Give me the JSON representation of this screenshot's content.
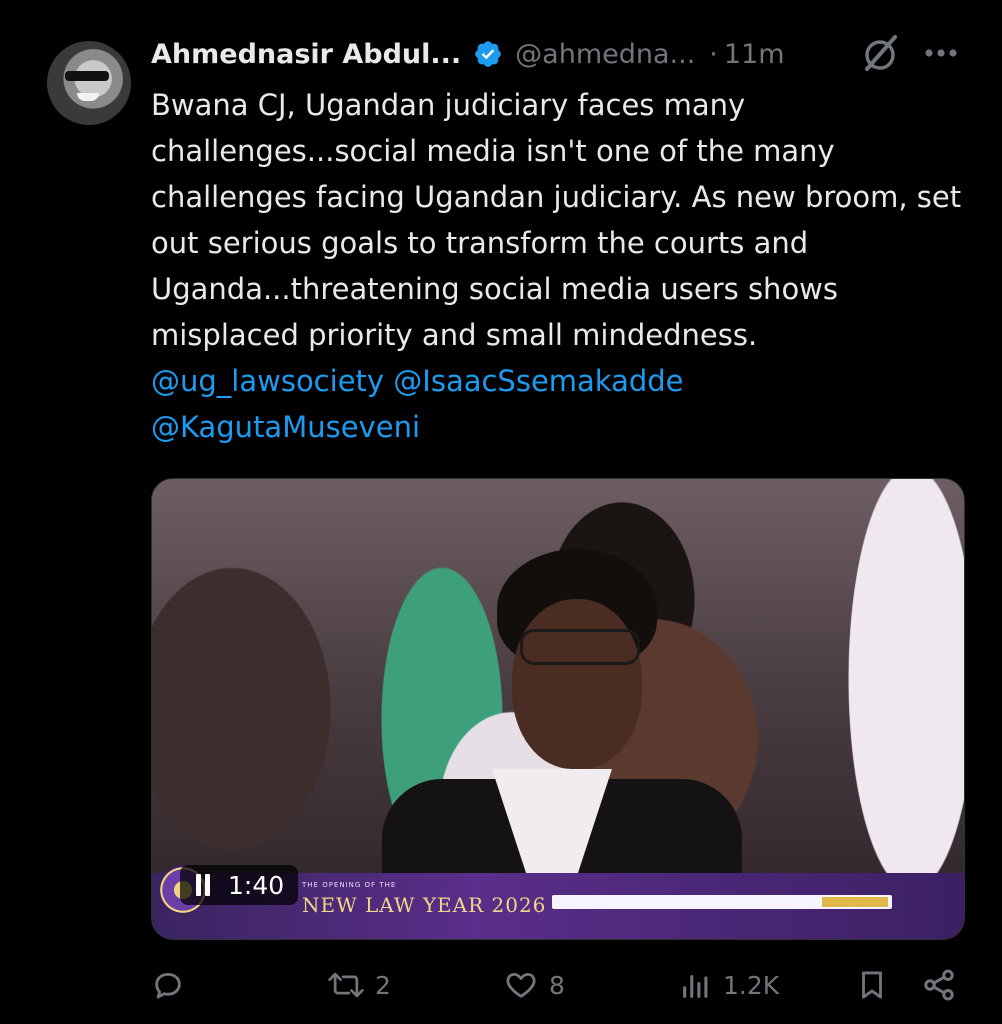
{
  "author": {
    "name": "Ahmednasir Abdul...",
    "handle": "@ahmedna...",
    "separator": "·",
    "time": "11m",
    "verified": true
  },
  "tweet": {
    "text": "Bwana CJ, Ugandan judiciary faces many challenges...social media isn't one of the many challenges facing Ugandan judiciary. As new broom, set out serious goals to transform the courts and Uganda...threatening social media users shows misplaced priority and small mindedness.",
    "mentions": [
      "@ug_lawsociety",
      "@IsaacSsemakadde",
      "@KagutaMuseveni"
    ]
  },
  "media": {
    "duration": "1:40",
    "banner_title": "NEW LAW YEAR 2026",
    "banner_subtitle": "THE OPENING OF THE"
  },
  "actions": {
    "reply_count": "",
    "retweet_count": "2",
    "like_count": "8",
    "views_count": "1.2K"
  },
  "icons": {
    "verified": "verified-badge-icon",
    "grok": "grok-icon",
    "more": "more-icon",
    "reply": "reply-icon",
    "retweet": "retweet-icon",
    "like": "heart-icon",
    "views": "views-icon",
    "bookmark": "bookmark-icon",
    "share": "share-icon",
    "pause": "pause-icon"
  },
  "colors": {
    "background": "#000000",
    "text": "#e7e9ea",
    "muted": "#71767b",
    "link": "#1d9bf0",
    "verified": "#1d9bf0"
  }
}
